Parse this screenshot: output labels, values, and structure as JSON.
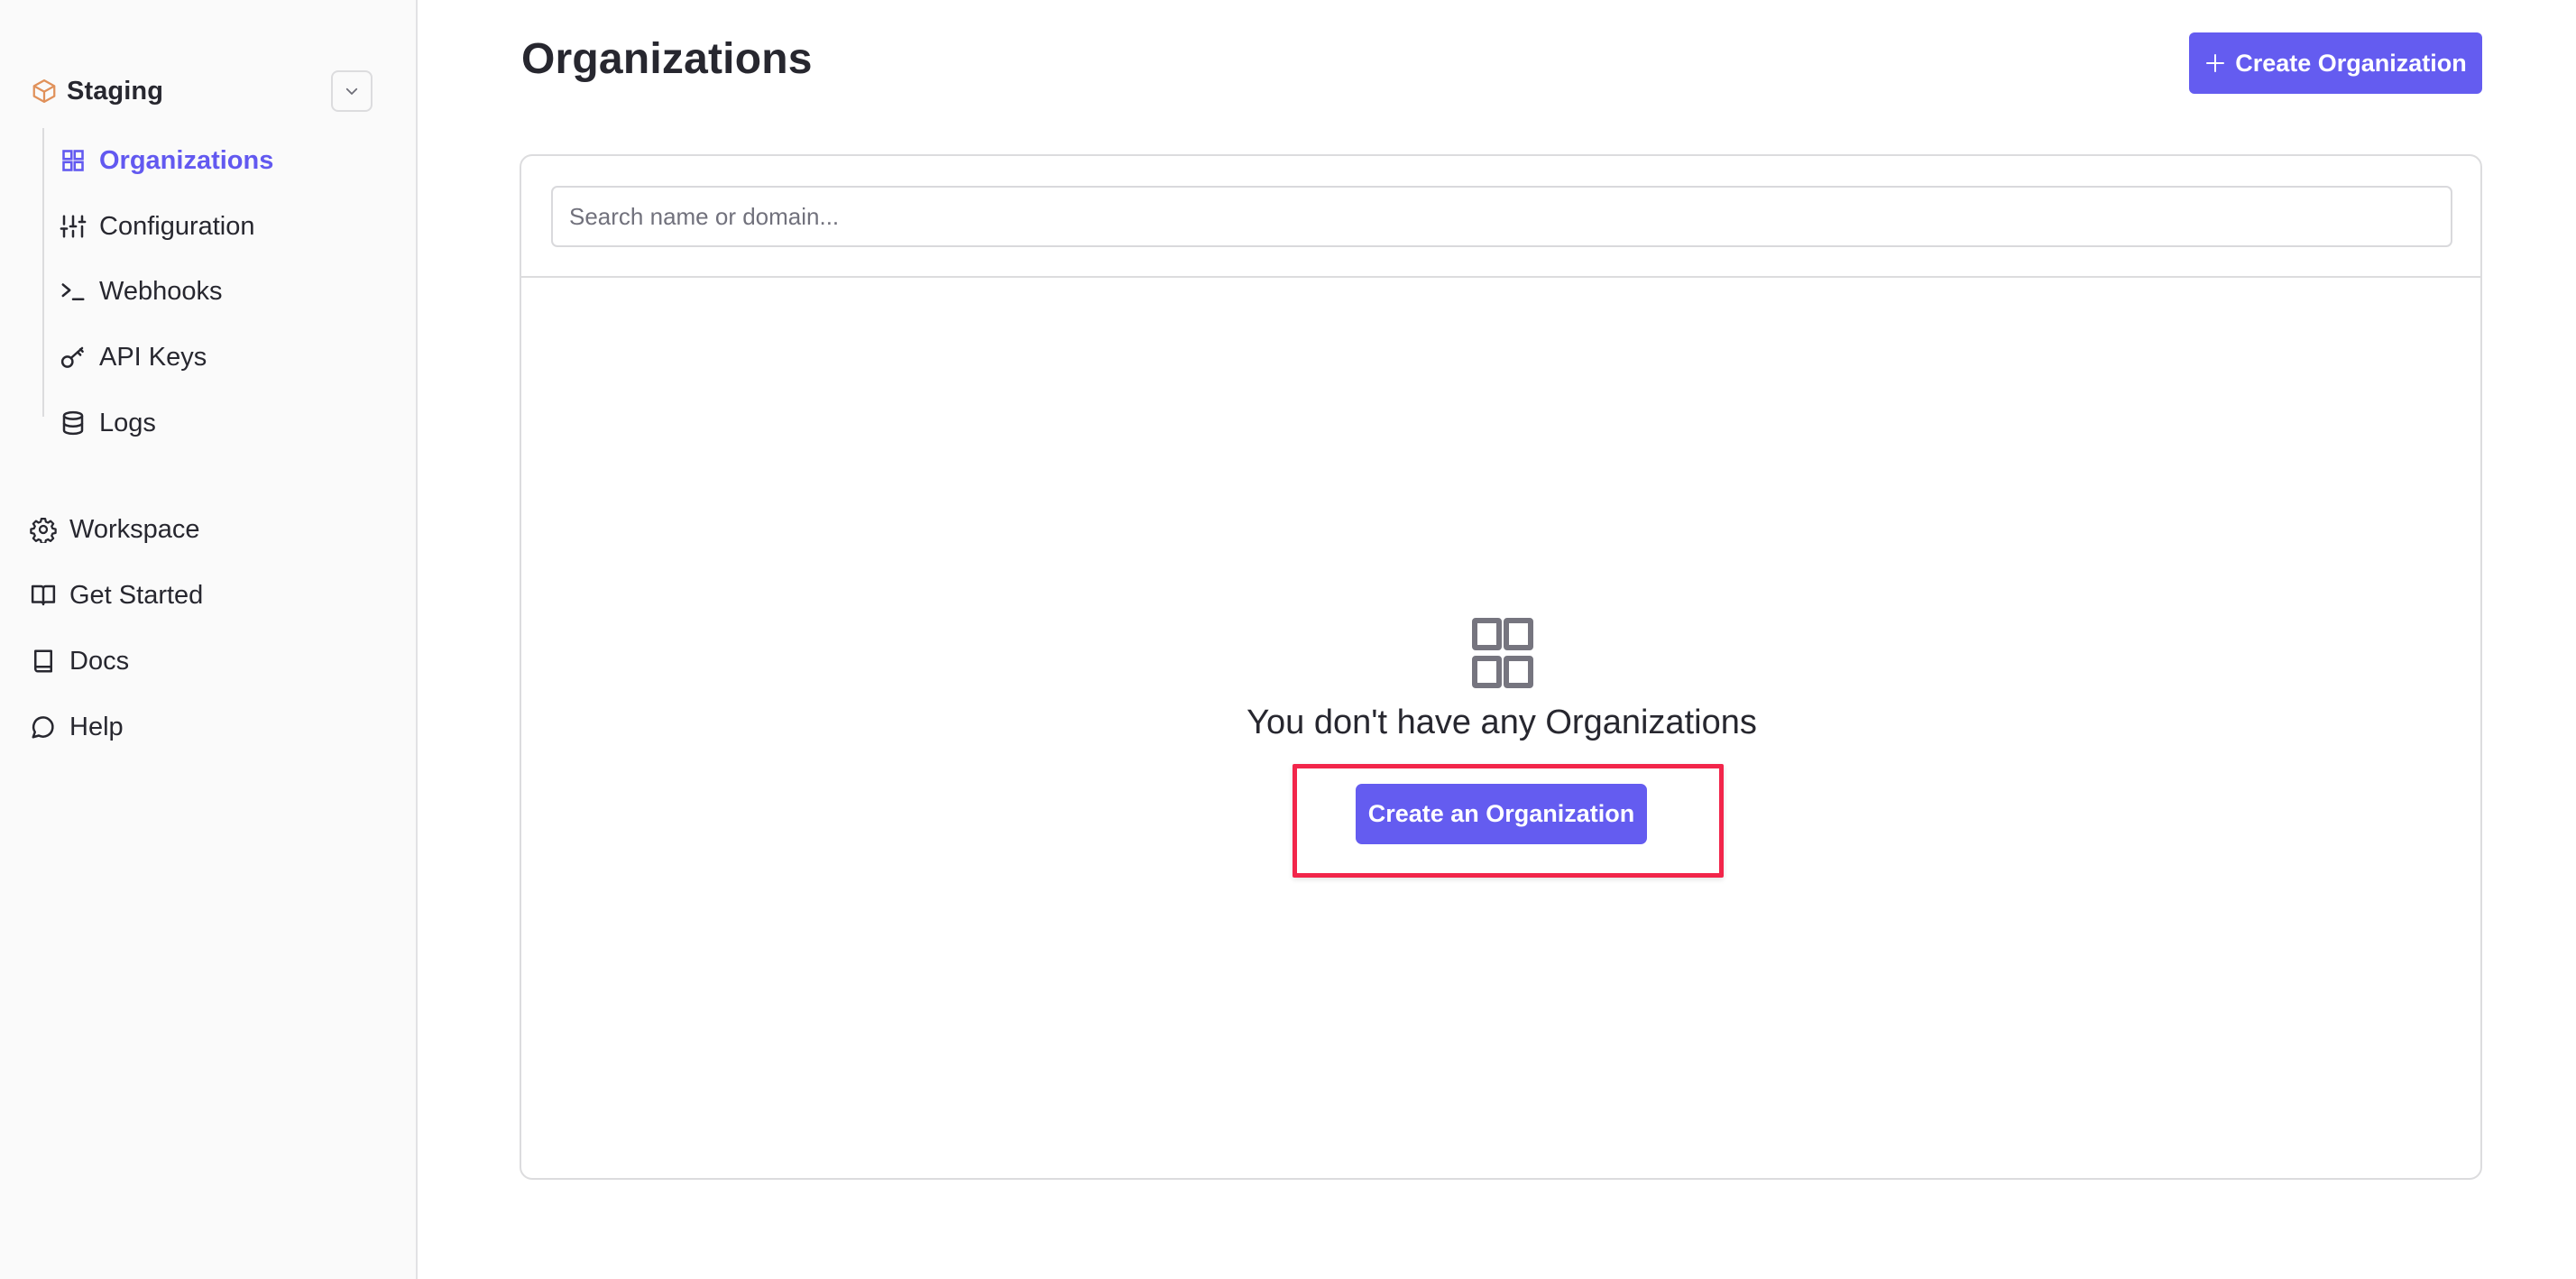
{
  "sidebar": {
    "environment": {
      "label": "Staging",
      "icon": "cube-icon",
      "icon_color": "#e0915a"
    },
    "env_items": [
      {
        "label": "Organizations",
        "icon": "grid-icon",
        "active": true
      },
      {
        "label": "Configuration",
        "icon": "sliders-icon",
        "active": false
      },
      {
        "label": "Webhooks",
        "icon": "terminal-icon",
        "active": false
      },
      {
        "label": "API Keys",
        "icon": "key-icon",
        "active": false
      },
      {
        "label": "Logs",
        "icon": "database-icon",
        "active": false
      }
    ],
    "global_items": [
      {
        "label": "Workspace",
        "icon": "gear-icon"
      },
      {
        "label": "Get Started",
        "icon": "book-open-icon"
      },
      {
        "label": "Docs",
        "icon": "book-icon"
      },
      {
        "label": "Help",
        "icon": "chat-bubble-icon"
      }
    ]
  },
  "main": {
    "title": "Organizations",
    "create_button_label": "Create Organization",
    "search": {
      "placeholder": "Search name or domain...",
      "value": ""
    },
    "empty_state": {
      "icon": "grid-icon",
      "message": "You don't have any Organizations",
      "button_label": "Create an Organization"
    }
  },
  "colors": {
    "accent": "#645cf0",
    "active_nav": "#6259f0",
    "highlight": "#f2254a",
    "text": "#27272f",
    "muted": "#71717c",
    "border": "#dcdcde"
  }
}
